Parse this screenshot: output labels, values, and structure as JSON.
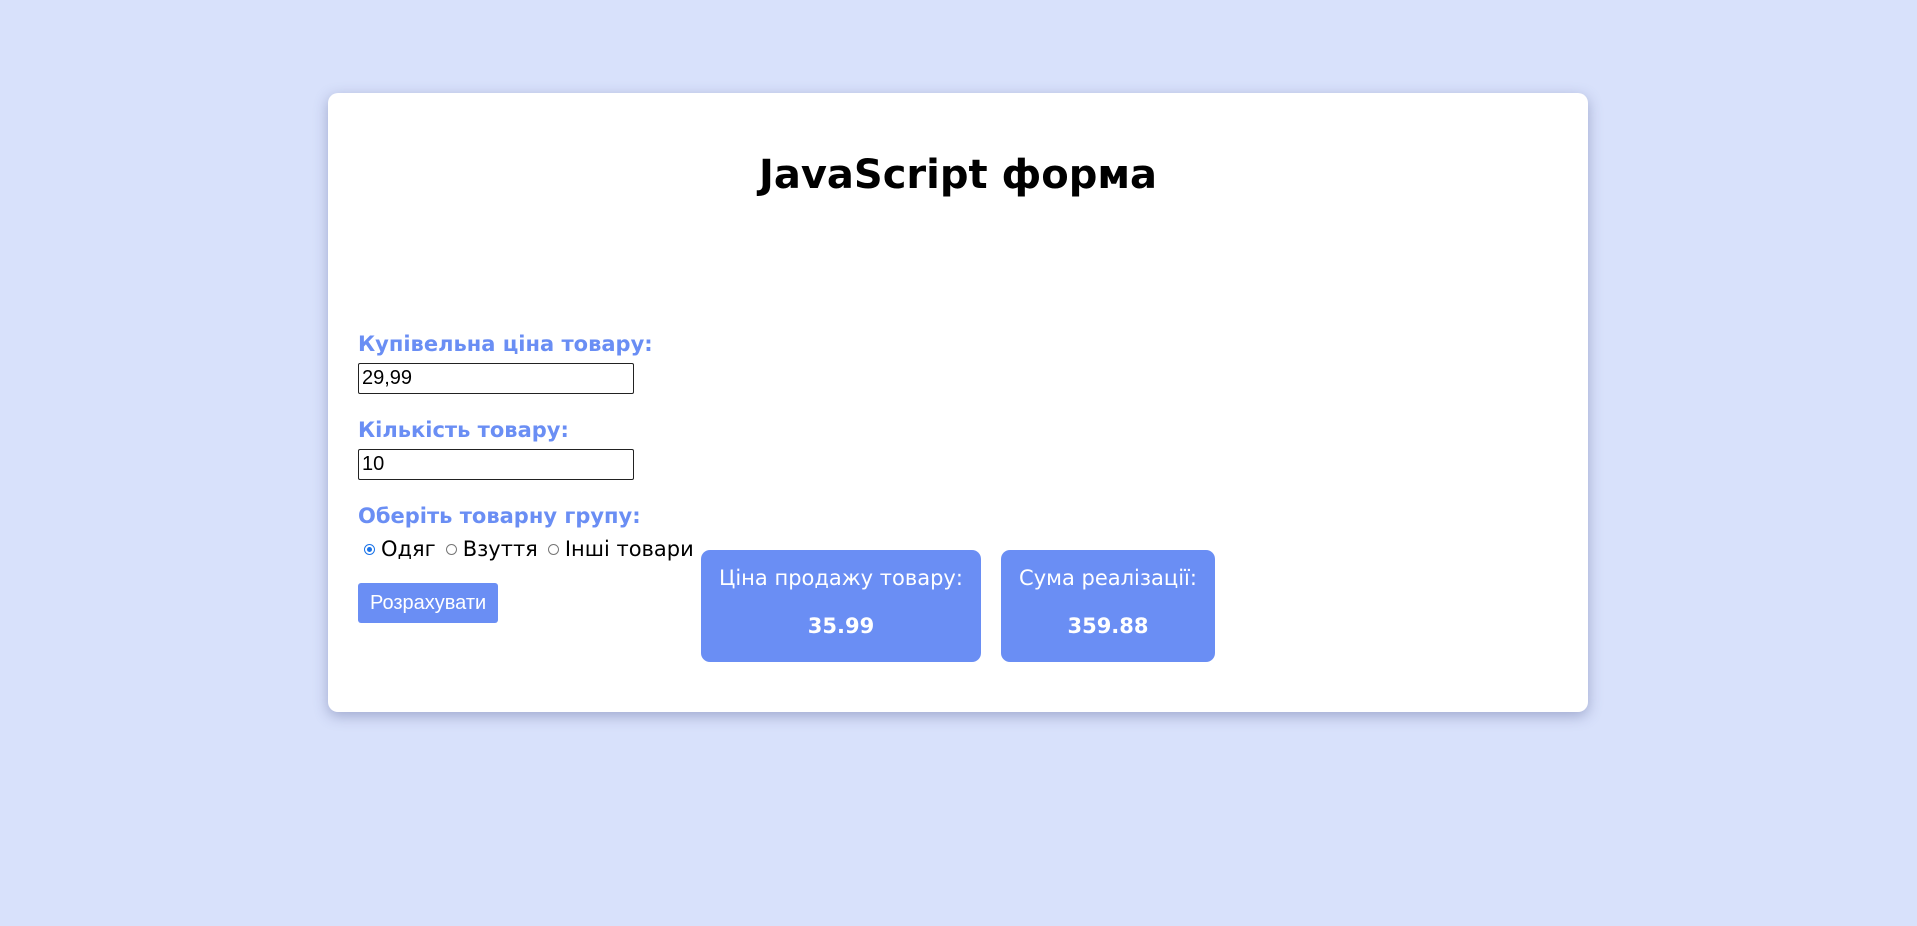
{
  "page": {
    "title": "JavaScript форма"
  },
  "form": {
    "price": {
      "label": "Купівельна ціна товару:",
      "value": "29,99"
    },
    "quantity": {
      "label": "Кількість товару:",
      "value": "10"
    },
    "group": {
      "label": "Оберіть товарну групу:",
      "options": [
        {
          "label": "Одяг",
          "checked": true
        },
        {
          "label": "Взуття",
          "checked": false
        },
        {
          "label": "Інші товари",
          "checked": false
        }
      ]
    },
    "calculate_label": "Розрахувати"
  },
  "results": [
    {
      "title": "Ціна продажу товару:",
      "value": "35.99"
    },
    {
      "title": "Сума реалізації:",
      "value": "359.88"
    }
  ],
  "colors": {
    "background": "#d8e1fb",
    "accent": "#6a8ef4",
    "card": "#ffffff"
  }
}
